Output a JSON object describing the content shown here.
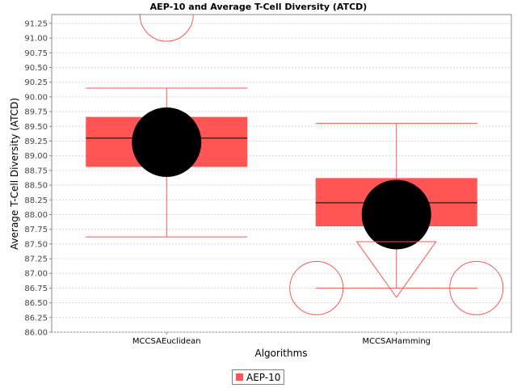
{
  "chart_data": {
    "type": "box",
    "title": "AEP-10 and Average T-Cell Diversity (ATCD)",
    "xlabel": "Algorithms",
    "ylabel": "Average T-Cell Diversity (ATCD)",
    "ylim": [
      86.0,
      91.4
    ],
    "yticks": [
      86.0,
      86.25,
      86.5,
      86.75,
      87.0,
      87.25,
      87.5,
      87.75,
      88.0,
      88.25,
      88.5,
      88.75,
      89.0,
      89.25,
      89.5,
      89.75,
      90.0,
      90.25,
      90.5,
      90.75,
      91.0,
      91.25
    ],
    "ytick_labels": [
      "86.00",
      "86.25",
      "86.50",
      "86.75",
      "87.00",
      "87.25",
      "87.50",
      "87.75",
      "88.00",
      "88.25",
      "88.50",
      "88.75",
      "89.00",
      "89.25",
      "89.50",
      "89.75",
      "90.00",
      "90.25",
      "90.50",
      "90.75",
      "91.00",
      "91.25"
    ],
    "grid": true,
    "legend_position": "bottom-center",
    "series": [
      {
        "name": "AEP-10",
        "color": "#ff5555"
      }
    ],
    "categories": [
      "MCCSAEuclidean",
      "MCCSAHamming"
    ],
    "boxes": [
      {
        "category": "MCCSAEuclidean",
        "min": 87.62,
        "q1": 88.81,
        "median": 89.3,
        "q3": 89.66,
        "max": 90.15,
        "mean": 89.23,
        "outliers": [
          91.4
        ],
        "far_outliers": []
      },
      {
        "category": "MCCSAHamming",
        "min": 86.75,
        "q1": 87.8,
        "median": 88.2,
        "q3": 88.62,
        "max": 89.55,
        "mean": 88.0,
        "outliers": [
          86.75,
          86.75
        ],
        "far_outliers": [
          87.1
        ]
      }
    ]
  }
}
